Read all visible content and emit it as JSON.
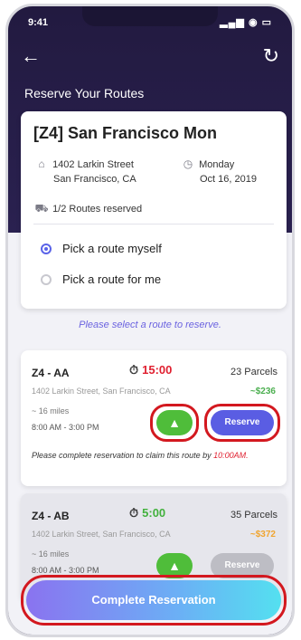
{
  "status": {
    "time": "9:41",
    "icons": "▂▄▆ ◉ ▭"
  },
  "nav": {
    "back_icon": "←",
    "refresh_icon": "↻"
  },
  "page_title": "Reserve Your Routes",
  "summary": {
    "title": "[Z4] San Francisco Mon",
    "address_line1": "1402 Larkin Street",
    "address_line2": "San Francisco, CA",
    "day": "Monday",
    "date": "Oct 16, 2019",
    "reserved": "1/2  Routes reserved",
    "options": [
      "Pick a route myself",
      "Pick a route for me"
    ],
    "selected_option": 0
  },
  "prompt": "Please select a route to reserve.",
  "routes": [
    {
      "code": "Z4 - AA",
      "timer": "15:00",
      "parcels": "23 Parcels",
      "street": "1402 Larkin Street, San Francisco, CA",
      "price": "~$236",
      "miles": "~ 16 miles",
      "hours": "8:00 AM - 3:00 PM",
      "reserve_label": "Reserve",
      "note": "Please complete reservation to claim this route by ",
      "deadline": "10:00AM."
    },
    {
      "code": "Z4 - AB",
      "timer": "5:00",
      "parcels": "35 Parcels",
      "street": "1402 Larkin Street, San Francisco, CA",
      "price": "~$372",
      "miles": "~ 16 miles",
      "hours": "8:00 AM - 3:00 PM",
      "reserve_label": "Reserve"
    }
  ],
  "complete_label": "Complete Reservation",
  "colors": {
    "header": "#221a40",
    "accent": "#5a5de3",
    "map_button": "#4fbd3a",
    "highlight": "#d3181f",
    "timer_urgent": "#e02030",
    "timer_ok": "#42b13d"
  }
}
